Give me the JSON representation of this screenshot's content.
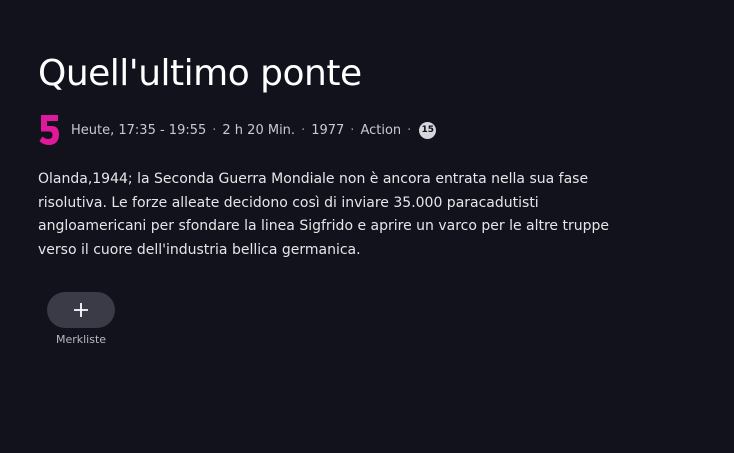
{
  "program": {
    "title": "Quell'ultimo ponte",
    "channel_logo_text": "5",
    "brand_color": "#e0189a",
    "meta": {
      "airtime": "Heute, 17:35 - 19:55",
      "duration": "2 h 20 Min.",
      "year": "1977",
      "genre": "Action",
      "separator": "·",
      "age_rating": "15"
    },
    "description": "Olanda,1944; la Seconda Guerra Mondiale non è ancora entrata nella sua fase risolutiva. Le forze alleate decidono così di inviare 35.000 paracadutisti angloamericani per sfondare la linea Sigfrido e aprire un varco per le altre truppe verso il cuore dell'industria bellica germanica."
  },
  "actions": {
    "watchlist_icon": "plus-icon",
    "watchlist_label": "Merkliste"
  }
}
